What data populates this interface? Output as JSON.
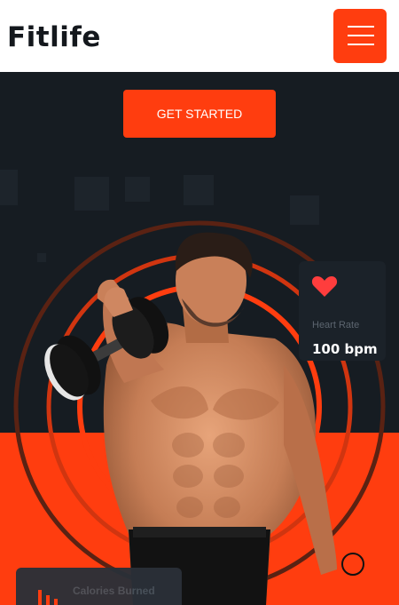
{
  "header": {
    "brand": "Fitlife",
    "menu_icon": "hamburger-menu-icon",
    "accent_color": "#ff3d0f"
  },
  "hero": {
    "cta_label": "GET STARTED",
    "background_color": "#161c22",
    "accent_color": "#ff3d0f"
  },
  "stats": {
    "heart_rate": {
      "icon": "heart-icon",
      "label": "Heart Rate",
      "value": "100 bpm"
    },
    "calories": {
      "icon": "bar-chart-icon",
      "label": "Calories Burned"
    }
  }
}
